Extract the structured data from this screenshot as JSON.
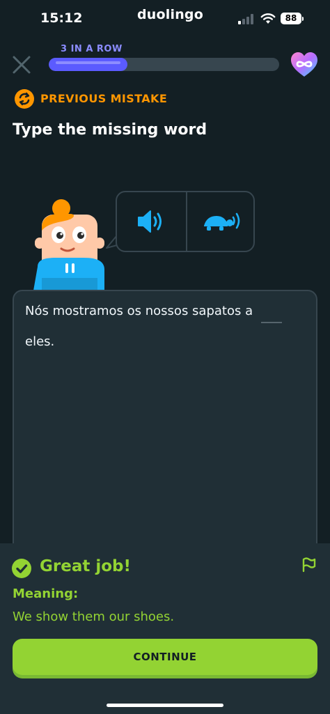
{
  "status_bar": {
    "time": "15:12",
    "app_name": "duolingo",
    "battery": "88"
  },
  "header": {
    "streak_label": "3 IN A ROW",
    "progress": 0.34,
    "accent": "#5b5bff"
  },
  "prompt": {
    "badge": "PREVIOUS MISTAKE",
    "title": "Type the missing word"
  },
  "exercise": {
    "sentence_line1": "Nós mostramos os nossos sapatos a",
    "sentence_line2": "eles.",
    "audio_buttons": [
      "speaker-icon",
      "turtle-slow-audio-icon"
    ]
  },
  "feedback": {
    "heading": "Great job!",
    "meaning_label": "Meaning:",
    "meaning_text": "We show them our shoes.",
    "continue_label": "CONTINUE",
    "color": "#93d333"
  }
}
